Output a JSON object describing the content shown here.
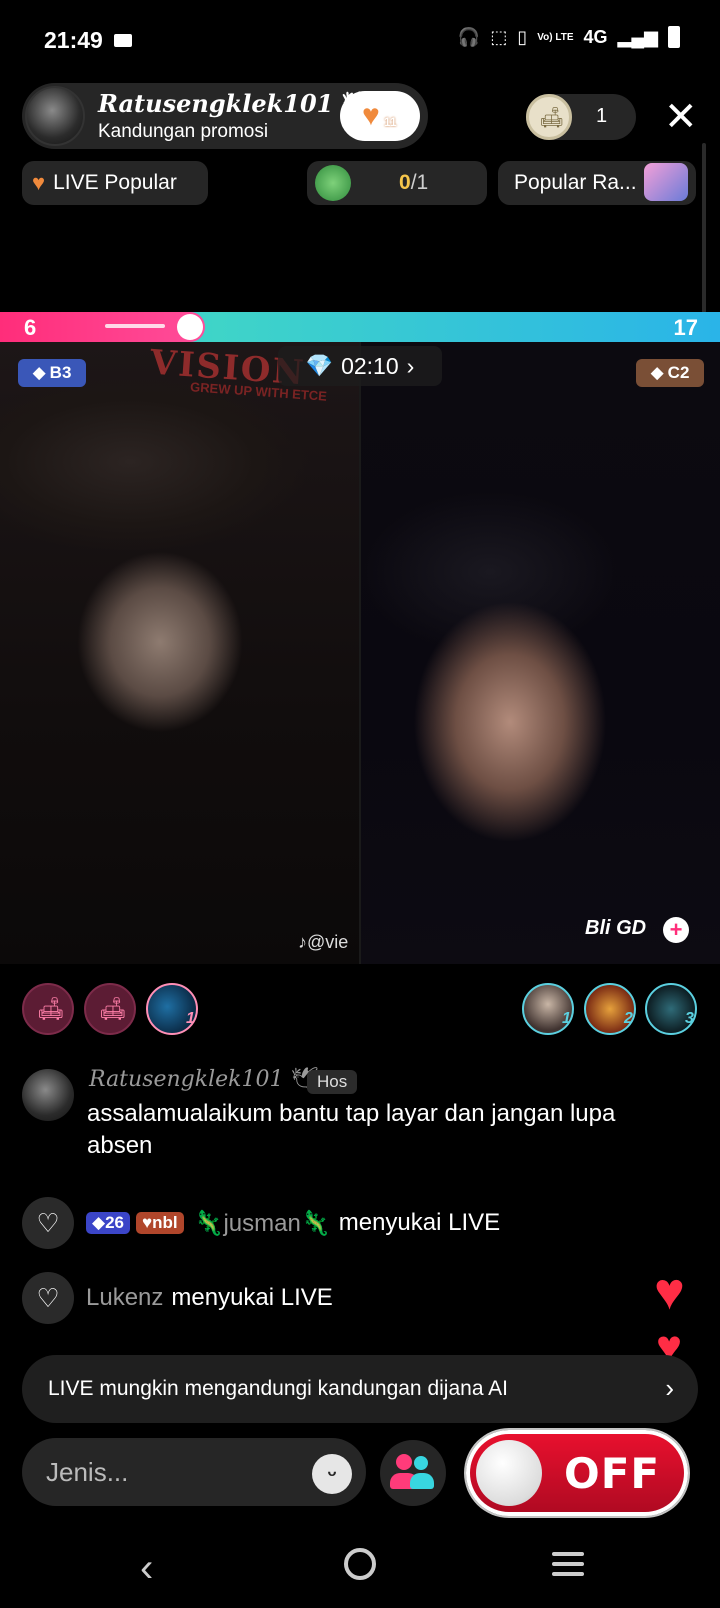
{
  "status_bar": {
    "time": "21:49",
    "network": "4G",
    "volte": "Vo) LTE"
  },
  "host": {
    "name": "Ratusengklek101",
    "subtitle": "Kandungan promosi",
    "fan_count": "11"
  },
  "viewers": {
    "count": "1"
  },
  "chips": {
    "live_popular": "LIVE Popular",
    "progress_done": "0",
    "progress_total": "/1",
    "popular_rank": "Popular Ra..."
  },
  "battle": {
    "score_left": "6",
    "score_right": "17",
    "timer": "02:10",
    "badge_left": "B3",
    "badge_right": "C2",
    "left_cap_text": "VISION",
    "left_cap_subtext": "GREW UP WITH ETCE",
    "watermark": "@vie",
    "opponent_name": "Bli GD"
  },
  "gifters": {
    "left_rank": "1",
    "right_ranks": [
      "1",
      "2",
      "3"
    ]
  },
  "chat": {
    "host_message": {
      "name": "Ratusengklek101",
      "tag": "Hos",
      "text": "assalamualaikum bantu tap layar dan jangan lupa absen"
    },
    "likes": [
      {
        "level": "26",
        "fan_badge": "nbl",
        "user": "🦎jusman🦎",
        "text": "menyukai LIVE"
      },
      {
        "user": "Lukenz",
        "text": "menyukai LIVE"
      }
    ]
  },
  "disclaimer": "LIVE mungkin mengandungi kandungan dijana AI",
  "input": {
    "placeholder": "Jenis..."
  },
  "toggle": {
    "label": "OFF"
  },
  "colors": {
    "battle_left": "#ff2d7a",
    "battle_right": "#29c8e2",
    "toggle_red": "#e8102e"
  }
}
